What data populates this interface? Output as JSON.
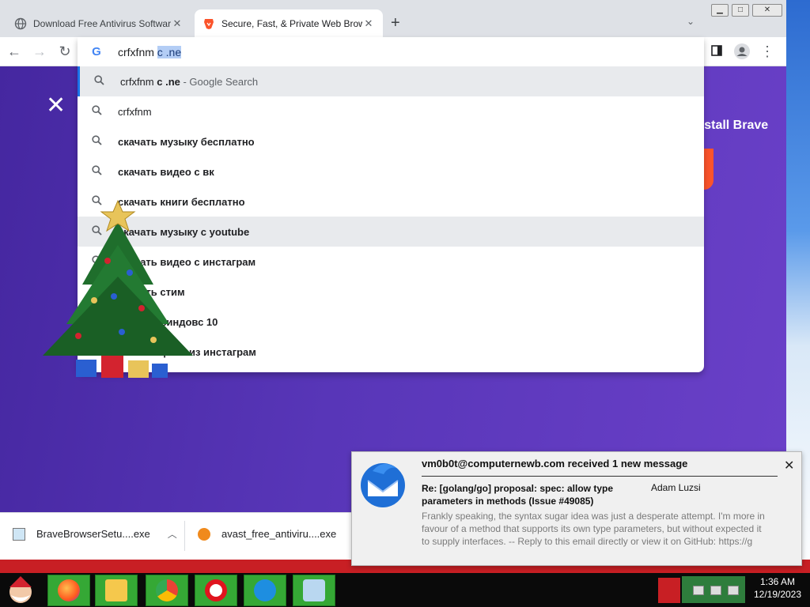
{
  "browser": {
    "tabs": [
      {
        "title": "Download Free Antivirus Software",
        "active": false
      },
      {
        "title": "Secure, Fast, & Private Web Browser",
        "active": true
      }
    ],
    "new_tab": "+",
    "tab_close": "✕"
  },
  "omnibox": {
    "typed": "crfxfnm ",
    "selected": "c .ne",
    "suggestions": [
      {
        "plain": "crfxfnm ",
        "bold": "c .ne",
        "hint": " - Google Search",
        "highlighted": true
      },
      {
        "plain": "crfxfnm",
        "bold": "",
        "hint": "",
        "highlighted": false
      },
      {
        "plain": "",
        "bold": "скачать музыку бесплатно",
        "hint": "",
        "highlighted": false
      },
      {
        "plain": "",
        "bold": "скачать видео с вк",
        "hint": "",
        "highlighted": false
      },
      {
        "plain": "",
        "bold": "скачать книги бесплатно",
        "hint": "",
        "highlighted": false
      },
      {
        "plain": "",
        "bold": "скачать музыку с youtube",
        "hint": "",
        "highlighted": true
      },
      {
        "plain": "",
        "bold": "скачать видео с инстаграм",
        "hint": "",
        "highlighted": false
      },
      {
        "plain": "",
        "bold": "скачать стим",
        "hint": "",
        "highlighted": false
      },
      {
        "plain": "",
        "bold": "скачать виндовс 10",
        "hint": "",
        "highlighted": false
      },
      {
        "plain": "",
        "bold": "скачать фото из инстаграм",
        "hint": "",
        "highlighted": false
      }
    ]
  },
  "page": {
    "close_glyph": "✕",
    "install_text": "Install Brave"
  },
  "downloads": [
    {
      "name": "BraveBrowserSetu....exe"
    },
    {
      "name": "avast_free_antiviru....exe"
    }
  ],
  "notification": {
    "title": "vm0b0t@computernewb.com received 1 new message",
    "subject": "Re: [golang/go] proposal: spec: allow type parameters in methods (Issue #49085)",
    "sender": "Adam Luzsi",
    "body": "Frankly speaking, the syntax sugar idea was just a desperate attempt. I'm more in favour of a method that supports its own type parameters, but without expected it to supply interfaces. -- Reply to this email directly or view it on GitHub: https://g",
    "close": "✕"
  },
  "taskbar": {
    "time": "1:36 AM",
    "date": "12/19/2023"
  },
  "colors": {
    "page_bg": "#5836b8",
    "brave_orange": "#fb542b",
    "taskbar_green": "#35a835",
    "highlight": "#e8eaed",
    "selection": "#b3cdf5"
  }
}
